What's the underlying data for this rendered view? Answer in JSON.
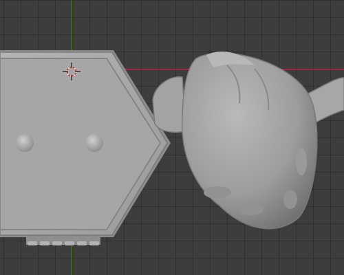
{
  "viewport": {
    "background": "#3d3d3d",
    "grid_color": "#2f2f2f",
    "x_axis_color": "#b0405a",
    "y_axis_color": "#4f8a2c"
  },
  "scene": {
    "objects": [
      {
        "name": "hexagon-base",
        "kind": "mesh",
        "color": "#a9a9a9"
      },
      {
        "name": "stud-left",
        "kind": "mesh",
        "color": "#b5b5b5"
      },
      {
        "name": "stud-right",
        "kind": "mesh",
        "color": "#b5b5b5"
      },
      {
        "name": "character-head",
        "kind": "mesh",
        "color": "#9e9e9e"
      },
      {
        "name": "character-arm-left",
        "kind": "mesh",
        "color": "#a5a5a5"
      },
      {
        "name": "character-arm-right",
        "kind": "mesh",
        "color": "#a5a5a5"
      }
    ]
  },
  "cursor": {
    "icon": "3d-cursor-icon"
  }
}
